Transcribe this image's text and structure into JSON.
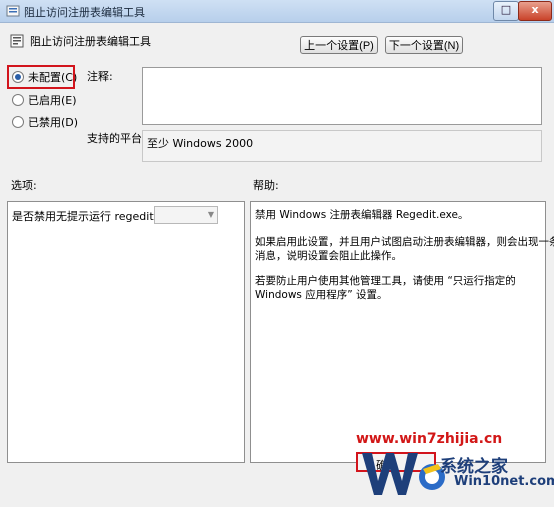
{
  "window": {
    "title": "阻止访问注册表编辑工具",
    "max_glyph": "□",
    "close_glyph": "x"
  },
  "header": {
    "policy_name": "阻止访问注册表编辑工具",
    "prev_button": "上一个设置(P)",
    "next_button": "下一个设置(N)"
  },
  "radios": [
    {
      "label": "未配置(C)",
      "checked": true
    },
    {
      "label": "已启用(E)",
      "checked": false
    },
    {
      "label": "已禁用(D)",
      "checked": false
    }
  ],
  "comment": {
    "label": "注释:",
    "value": ""
  },
  "platform": {
    "label": "支持的平台:",
    "value": "至少 Windows 2000"
  },
  "options": {
    "label": "选项:",
    "item_text": "是否禁用无提示运行 regedit ?",
    "combo_value": ""
  },
  "help": {
    "label": "帮助:",
    "lines": [
      "禁用 Windows 注册表编辑器 Regedit.exe。",
      "",
      "如果启用此设置，并且用户试图启动注册表编辑器，则会出现一条",
      "消息，说明设置会阻止此操作。",
      "",
      "若要防止用户使用其他管理工具，请使用 “只运行指定的",
      "Windows 应用程序” 设置。"
    ]
  },
  "footer": {
    "ok_button_partial": "确"
  },
  "watermarks": {
    "url": "www.win7zhijia.cn",
    "brand": "系统之家",
    "site": "Win10net.com",
    "accent_red": "#d21717",
    "accent_blue": "#1e3f7a"
  }
}
